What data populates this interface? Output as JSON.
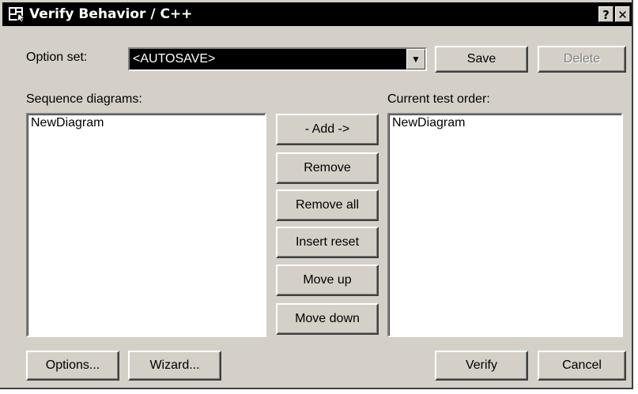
{
  "window": {
    "title": "Verify Behavior / C++",
    "help_label": "?",
    "close_label": "✕"
  },
  "option_set": {
    "label": "Option set:",
    "value": "<AUTOSAVE>",
    "save_label": "Save",
    "delete_label": "Delete"
  },
  "sequence_diagrams": {
    "label": "Sequence diagrams:",
    "items": [
      "NewDiagram"
    ]
  },
  "test_order": {
    "label": "Current test order:",
    "items": [
      "NewDiagram"
    ]
  },
  "middle_buttons": {
    "add": "- Add ->",
    "remove": "Remove",
    "remove_all": "Remove all",
    "insert_reset": "Insert reset",
    "move_up": "Move up",
    "move_down": "Move down"
  },
  "footer": {
    "options": "Options...",
    "wizard": "Wizard...",
    "verify": "Verify",
    "cancel": "Cancel"
  },
  "icons": {
    "app": "app-window-icon",
    "dropdown": "chevron-down-icon"
  },
  "colors": {
    "face": "#d4d0c8",
    "titlebar": "#000000",
    "selection": "#000000",
    "disabled_text": "#808080"
  }
}
